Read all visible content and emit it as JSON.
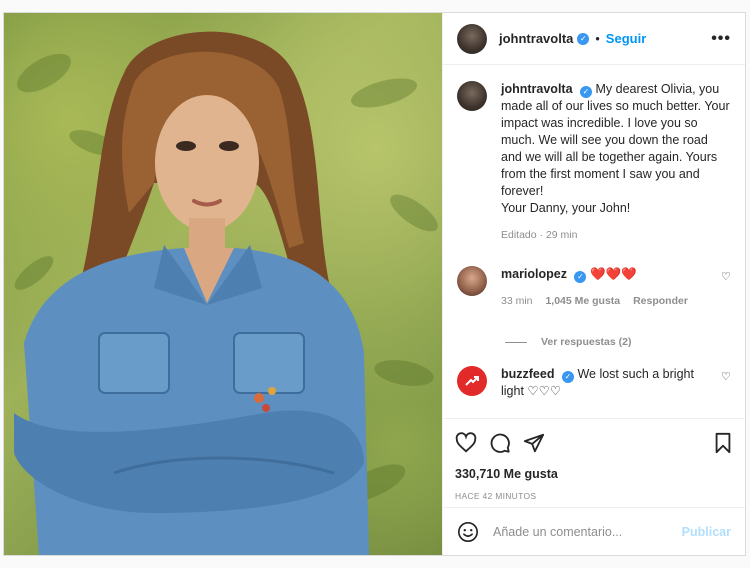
{
  "post": {
    "username": "johntravolta",
    "follow_label": "Seguir",
    "more_label": "•••",
    "caption": "My dearest Olivia, you made all of our lives so much better. Your impact was incredible. I love you so much. We will see you down the road and we will all be together again. Yours from the first moment I saw you and forever!",
    "caption_signoff": "Your Danny, your John!",
    "caption_meta": "Editado · 29 min"
  },
  "comments": [
    {
      "username": "mariolopez",
      "text": "❤️❤️❤️",
      "time": "33 min",
      "likes": "1,045 Me gusta",
      "reply_label": "Responder"
    },
    {
      "username": "buzzfeed",
      "text": "We lost such a bright light ♡♡♡"
    }
  ],
  "view_replies_label": "Ver respuestas (2)",
  "likes_label": "330,710 Me gusta",
  "time_ago": "HACE 42 MINUTOS",
  "add_comment": {
    "placeholder": "Añade un comentario...",
    "publish_label": "Publicar"
  },
  "colors": {
    "accent": "#0095f6",
    "verified": "#3897f0",
    "heart_red": "#ed4956",
    "publish_disabled": "#b2dffc"
  },
  "icons": [
    "check-icon",
    "heart-icon",
    "comment-icon",
    "share-icon",
    "bookmark-icon",
    "emoji-icon",
    "more-icon"
  ]
}
